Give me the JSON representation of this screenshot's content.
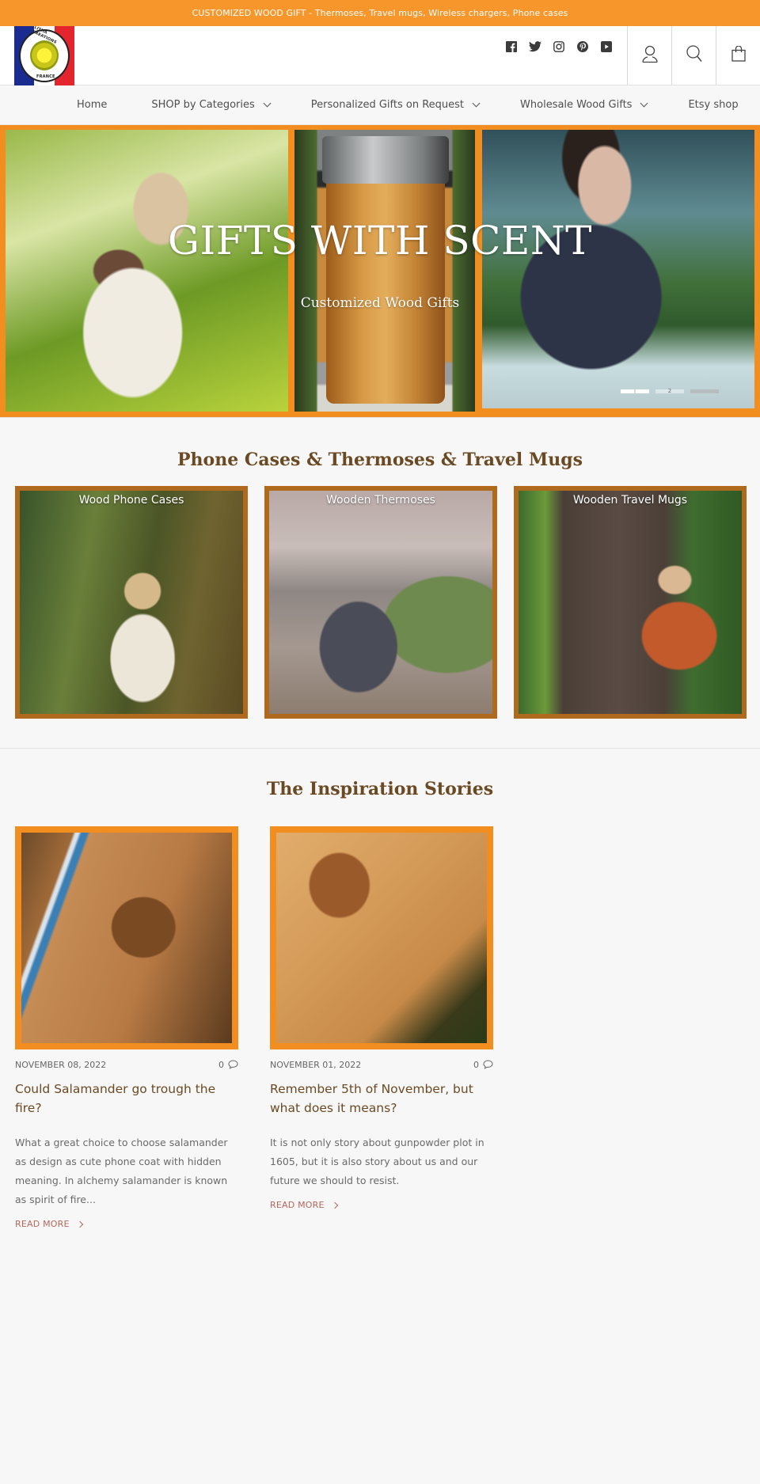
{
  "announcement": "CUSTOMIZED WOOD GIFT - Thermoses, Travel mugs, Wireless chargers, Phone cases",
  "logo": {
    "alt": "Litha Creations France",
    "top_text": "LITHA CREATIONS",
    "bottom_text": "FRANCE",
    "colors": {
      "blue": "#1a2c8f",
      "red": "#e3262d",
      "sun": "#fff23a"
    }
  },
  "header": {
    "social": [
      {
        "name": "facebook",
        "icon": "facebook-icon"
      },
      {
        "name": "twitter",
        "icon": "twitter-icon"
      },
      {
        "name": "instagram",
        "icon": "instagram-icon"
      },
      {
        "name": "pinterest",
        "icon": "pinterest-icon"
      },
      {
        "name": "youtube",
        "icon": "youtube-icon"
      }
    ],
    "account_icon": "user-icon",
    "search_icon": "search-icon",
    "cart_icon": "shopping-bag-icon"
  },
  "nav": {
    "items": [
      {
        "label": "Home",
        "dropdown": false
      },
      {
        "label": "SHOP by Categories",
        "dropdown": true
      },
      {
        "label": "Personalized Gifts on Request",
        "dropdown": true
      },
      {
        "label": "Wholesale Wood Gifts",
        "dropdown": true
      },
      {
        "label": "Etsy shop",
        "dropdown": false
      }
    ]
  },
  "hero": {
    "title": "GIFTS WITH SCENT",
    "subtitle": "Customized Wood Gifts",
    "slides": [
      "1",
      "2",
      "3"
    ],
    "active_slide": 1,
    "border_color": "#f28e1f"
  },
  "categories": {
    "title": "Phone Cases & Thermoses & Travel Mugs",
    "items": [
      {
        "label": "Wood Phone Cases"
      },
      {
        "label": "Wooden Thermoses"
      },
      {
        "label": "Wooden Travel Mugs"
      }
    ],
    "frame_color": "#b06a1e"
  },
  "blog": {
    "title": "The Inspiration Stories",
    "posts": [
      {
        "date": "NOVEMBER 08, 2022",
        "comments": "0",
        "title": "Could Salamander go trough the fire?",
        "excerpt": "What a great choice to choose salamander as design as cute phone coat with hidden meaning. In alchemy salamander is known as spirit of fire...",
        "read_more": "READ MORE"
      },
      {
        "date": "NOVEMBER 01, 2022",
        "comments": "0",
        "title": "Remember 5th of November, but what does it means?",
        "excerpt": "It is not only story about gunpowder plot in 1605, but it is also story about us and our future we should to resist.",
        "read_more": "READ MORE"
      }
    ]
  },
  "colors": {
    "accent": "#f7962a",
    "heading": "#6b4a23",
    "link": "#b5665a",
    "background": "#f7f7f7"
  }
}
